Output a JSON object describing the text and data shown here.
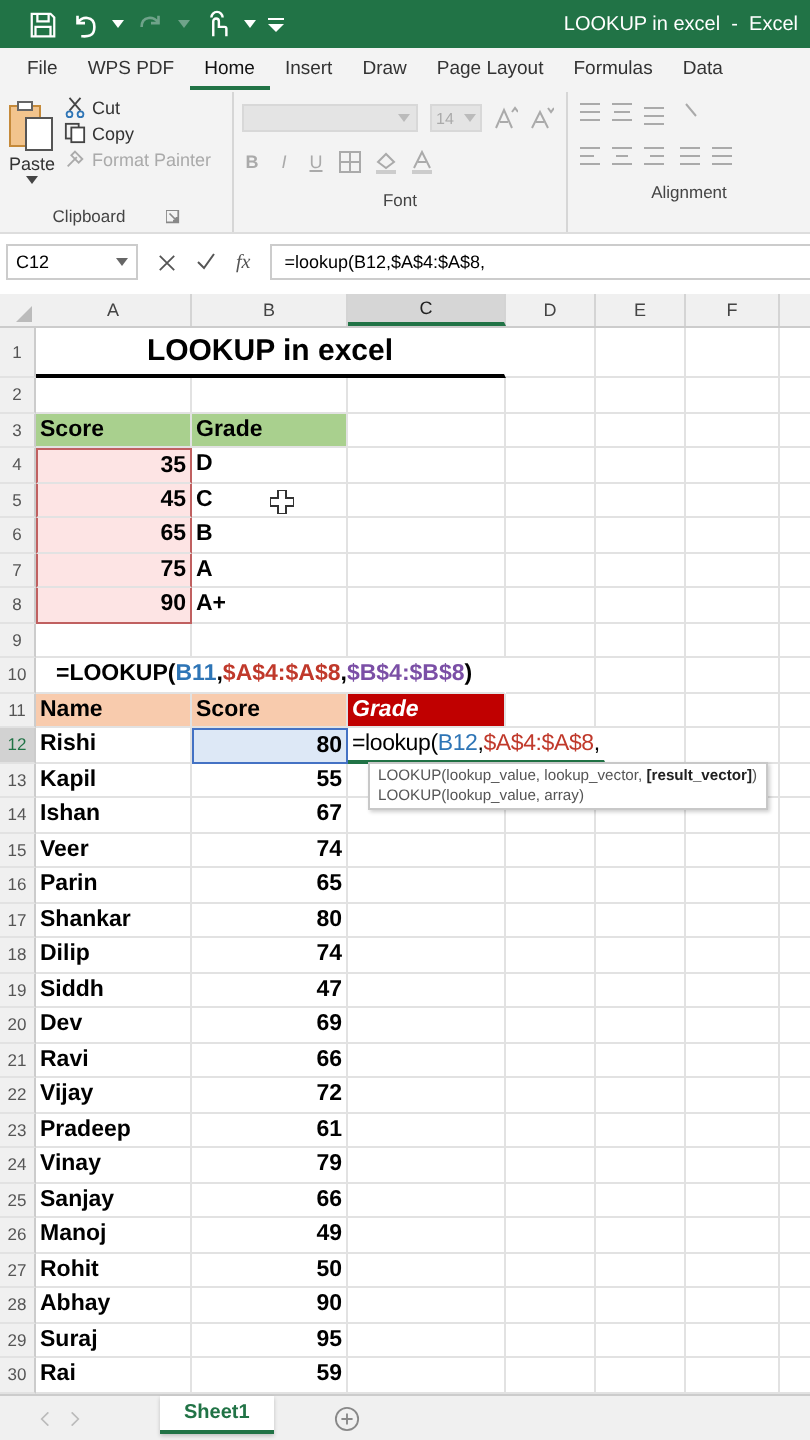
{
  "window": {
    "title": "LOOKUP in excel  -  Excel"
  },
  "ribbon_tabs": [
    {
      "label": "File",
      "selected": false
    },
    {
      "label": "WPS PDF",
      "selected": false
    },
    {
      "label": "Home",
      "selected": true
    },
    {
      "label": "Insert",
      "selected": false
    },
    {
      "label": "Draw",
      "selected": false
    },
    {
      "label": "Page Layout",
      "selected": false
    },
    {
      "label": "Formulas",
      "selected": false
    },
    {
      "label": "Data",
      "selected": false
    }
  ],
  "clipboard": {
    "paste": "Paste",
    "items": [
      {
        "label": "Cut",
        "disabled": false
      },
      {
        "label": "Copy",
        "disabled": false
      },
      {
        "label": "Format Painter",
        "disabled": true
      }
    ],
    "group": "Clipboard"
  },
  "font": {
    "size": "14",
    "bold": "B",
    "italic": "I",
    "underline": "U",
    "group": "Font"
  },
  "alignment": {
    "group": "Alignment"
  },
  "formula_bar": {
    "name_box": "C12",
    "fx": "fx",
    "formula": "=lookup(B12,$A$4:$A$8,"
  },
  "columns": [
    {
      "label": "A",
      "selected": false
    },
    {
      "label": "B",
      "selected": false
    },
    {
      "label": "C",
      "selected": true
    },
    {
      "label": "D",
      "selected": false
    },
    {
      "label": "E",
      "selected": false
    },
    {
      "label": "F",
      "selected": false
    }
  ],
  "rows": [
    {
      "number": "1",
      "selected": false,
      "A": {
        "kind": "title",
        "text": "LOOKUP in excel"
      }
    },
    {
      "number": "2",
      "selected": false
    },
    {
      "number": "3",
      "selected": false,
      "A": {
        "kind": "green-header",
        "text": "Score"
      },
      "B": {
        "kind": "green-header",
        "text": "Grade"
      }
    },
    {
      "number": "4",
      "selected": false,
      "A": {
        "kind": "ref-number",
        "text": "35"
      },
      "B": {
        "kind": "text",
        "text": "D"
      }
    },
    {
      "number": "5",
      "selected": false,
      "A": {
        "kind": "ref-number",
        "text": "45"
      },
      "B": {
        "kind": "text",
        "text": "C"
      }
    },
    {
      "number": "6",
      "selected": false,
      "A": {
        "kind": "ref-number",
        "text": "65"
      },
      "B": {
        "kind": "text",
        "text": "B"
      }
    },
    {
      "number": "7",
      "selected": false,
      "A": {
        "kind": "ref-number",
        "text": "75"
      },
      "B": {
        "kind": "text",
        "text": "A"
      }
    },
    {
      "number": "8",
      "selected": false,
      "A": {
        "kind": "ref-number",
        "text": "90"
      },
      "B": {
        "kind": "text",
        "text": "A+"
      }
    },
    {
      "number": "9",
      "selected": false
    },
    {
      "number": "10",
      "selected": false,
      "A": {
        "kind": "formula",
        "parts": [
          {
            "text": "=LOOKUP(",
            "color": "#000000"
          },
          {
            "text": "B11",
            "color": "#2e75b6"
          },
          {
            "text": ",",
            "color": "#000000"
          },
          {
            "text": "$A$4:$A$8",
            "color": "#c0392b"
          },
          {
            "text": ",",
            "color": "#000000"
          },
          {
            "text": "$B$4:$B$8",
            "color": "#7b4fa6"
          },
          {
            "text": ")",
            "color": "#000000"
          }
        ]
      }
    },
    {
      "number": "11",
      "selected": false,
      "A": {
        "kind": "orange-header",
        "text": "Name"
      },
      "B": {
        "kind": "orange-header",
        "text": "Score"
      },
      "C": {
        "kind": "red-header",
        "text": "Grade"
      }
    },
    {
      "number": "12",
      "selected": true,
      "A": {
        "kind": "text",
        "text": "Rishi"
      },
      "B": {
        "kind": "ref-blue-number",
        "text": "80"
      },
      "C": {
        "kind": "editing",
        "parts": [
          {
            "text": "=lookup(",
            "color": "#000000"
          },
          {
            "text": "B12",
            "color": "#2e75b6"
          },
          {
            "text": ",",
            "color": "#000000"
          },
          {
            "text": "$A$4:$A$8",
            "color": "#c0392b"
          },
          {
            "text": ",",
            "color": "#000000"
          }
        ]
      }
    },
    {
      "number": "13",
      "selected": false,
      "A": {
        "kind": "text",
        "text": "Kapil"
      },
      "B": {
        "kind": "number",
        "text": "55"
      }
    },
    {
      "number": "14",
      "selected": false,
      "A": {
        "kind": "text",
        "text": "Ishan"
      },
      "B": {
        "kind": "number",
        "text": "67"
      }
    },
    {
      "number": "15",
      "selected": false,
      "A": {
        "kind": "text",
        "text": "Veer"
      },
      "B": {
        "kind": "number",
        "text": "74"
      }
    },
    {
      "number": "16",
      "selected": false,
      "A": {
        "kind": "text",
        "text": "Parin"
      },
      "B": {
        "kind": "number",
        "text": "65"
      }
    },
    {
      "number": "17",
      "selected": false,
      "A": {
        "kind": "text",
        "text": "Shankar"
      },
      "B": {
        "kind": "number",
        "text": "80"
      }
    },
    {
      "number": "18",
      "selected": false,
      "A": {
        "kind": "text",
        "text": "Dilip"
      },
      "B": {
        "kind": "number",
        "text": "74"
      }
    },
    {
      "number": "19",
      "selected": false,
      "A": {
        "kind": "text",
        "text": "Siddh"
      },
      "B": {
        "kind": "number",
        "text": "47"
      }
    },
    {
      "number": "20",
      "selected": false,
      "A": {
        "kind": "text",
        "text": "Dev"
      },
      "B": {
        "kind": "number",
        "text": "69"
      }
    },
    {
      "number": "21",
      "selected": false,
      "A": {
        "kind": "text",
        "text": "Ravi"
      },
      "B": {
        "kind": "number",
        "text": "66"
      }
    },
    {
      "number": "22",
      "selected": false,
      "A": {
        "kind": "text",
        "text": "Vijay"
      },
      "B": {
        "kind": "number",
        "text": "72"
      }
    },
    {
      "number": "23",
      "selected": false,
      "A": {
        "kind": "text",
        "text": "Pradeep"
      },
      "B": {
        "kind": "number",
        "text": "61"
      }
    },
    {
      "number": "24",
      "selected": false,
      "A": {
        "kind": "text",
        "text": "Vinay"
      },
      "B": {
        "kind": "number",
        "text": "79"
      }
    },
    {
      "number": "25",
      "selected": false,
      "A": {
        "kind": "text",
        "text": "Sanjay"
      },
      "B": {
        "kind": "number",
        "text": "66"
      }
    },
    {
      "number": "26",
      "selected": false,
      "A": {
        "kind": "text",
        "text": "Manoj"
      },
      "B": {
        "kind": "number",
        "text": "49"
      }
    },
    {
      "number": "27",
      "selected": false,
      "A": {
        "kind": "text",
        "text": "Rohit"
      },
      "B": {
        "kind": "number",
        "text": "50"
      }
    },
    {
      "number": "28",
      "selected": false,
      "A": {
        "kind": "text",
        "text": "Abhay"
      },
      "B": {
        "kind": "number",
        "text": "90"
      }
    },
    {
      "number": "29",
      "selected": false,
      "A": {
        "kind": "text",
        "text": "Suraj"
      },
      "B": {
        "kind": "number",
        "text": "95"
      }
    },
    {
      "number": "30",
      "selected": false,
      "A": {
        "kind": "text",
        "text": "Rai"
      },
      "B": {
        "kind": "number",
        "text": "59"
      }
    }
  ],
  "tooltip": {
    "lines": [
      "LOOKUP(lookup_value, lookup_vector, **[result_vector]**)",
      "LOOKUP(lookup_value, array)"
    ]
  },
  "sheet_tabs": [
    {
      "label": "Sheet1",
      "selected": true
    }
  ]
}
